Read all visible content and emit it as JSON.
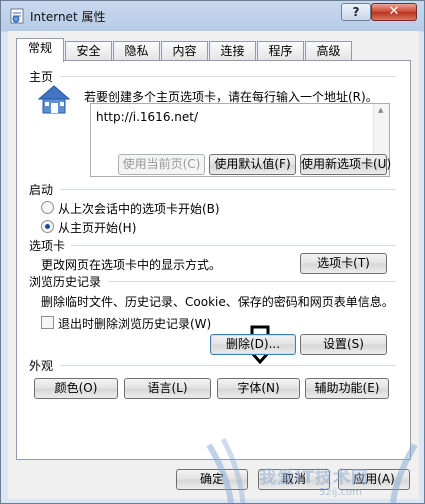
{
  "window": {
    "title": "Internet 属性",
    "help_label": "?",
    "close_label": "✕"
  },
  "tabs": [
    {
      "label": "常规",
      "active": true
    },
    {
      "label": "安全"
    },
    {
      "label": "隐私"
    },
    {
      "label": "内容"
    },
    {
      "label": "连接"
    },
    {
      "label": "程序"
    },
    {
      "label": "高级"
    }
  ],
  "homepage": {
    "section_label": "主页",
    "description": "若要创建多个主页选项卡，请在每行输入一个地址(R)。",
    "url_value": "http://i.1616.net/",
    "use_current_label": "使用当前页(C)",
    "use_default_label": "使用默认值(F)",
    "use_new_tab_label": "使用新选项卡(U)"
  },
  "startup": {
    "section_label": "启动",
    "option_last_session": "从上次会话中的选项卡开始(B)",
    "option_homepage": "从主页开始(H)",
    "selected": "option_homepage"
  },
  "tabs_section": {
    "section_label": "选项卡",
    "description": "更改网页在选项卡中的显示方式。",
    "button_label": "选项卡(T)"
  },
  "history": {
    "section_label": "浏览历史记录",
    "description": "删除临时文件、历史记录、Cookie、保存的密码和网页表单信息。",
    "checkbox_label": "退出时删除浏览历史记录(W)",
    "checkbox_checked": false,
    "delete_label": "删除(D)...",
    "settings_label": "设置(S)"
  },
  "appearance": {
    "section_label": "外观",
    "colors_label": "颜色(O)",
    "languages_label": "语言(L)",
    "fonts_label": "字体(N)",
    "accessibility_label": "辅助功能(E)"
  },
  "footer": {
    "ok_label": "确定",
    "cancel_label": "取消",
    "apply_label": "应用(A)"
  },
  "watermark": {
    "text": "我爱IT技术网",
    "url": "52ij.com"
  }
}
